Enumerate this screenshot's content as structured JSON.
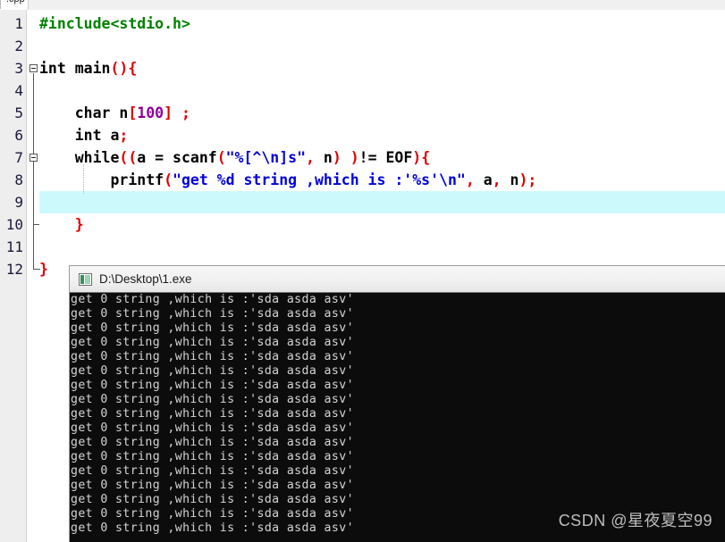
{
  "editor": {
    "tab_label": ".cpp",
    "gutter": {
      "line_numbers": [
        "1",
        "2",
        "3",
        "4",
        "5",
        "6",
        "7",
        "8",
        "9",
        "10",
        "11",
        "12"
      ]
    },
    "current_line": 9,
    "colors": {
      "preprocessor": "#008000",
      "punctuation": "#e00000",
      "string": "#0000dd",
      "number": "#9000a0",
      "plain": "#000000",
      "current_line_highlight": "#ccfafc",
      "gutter_background": "#eeeeee",
      "editor_background": "#ffffff"
    },
    "code_lines": [
      {
        "n": 1,
        "tokens": [
          {
            "t": "#include<stdio.h>",
            "c": "pre"
          }
        ]
      },
      {
        "n": 2,
        "tokens": []
      },
      {
        "n": 3,
        "tokens": [
          {
            "t": "int main",
            "c": "plain"
          },
          {
            "t": "(){",
            "c": "punc"
          }
        ]
      },
      {
        "n": 4,
        "tokens": []
      },
      {
        "n": 5,
        "tokens": [
          {
            "t": "    char n",
            "c": "plain"
          },
          {
            "t": "[",
            "c": "punc"
          },
          {
            "t": "100",
            "c": "num"
          },
          {
            "t": "]",
            "c": "punc"
          },
          {
            "t": " ",
            "c": "plain"
          },
          {
            "t": ";",
            "c": "punc"
          }
        ]
      },
      {
        "n": 6,
        "tokens": [
          {
            "t": "    int a",
            "c": "plain"
          },
          {
            "t": ";",
            "c": "punc"
          }
        ]
      },
      {
        "n": 7,
        "tokens": [
          {
            "t": "    while",
            "c": "plain"
          },
          {
            "t": "((",
            "c": "punc"
          },
          {
            "t": "a = scanf",
            "c": "plain"
          },
          {
            "t": "(",
            "c": "punc"
          },
          {
            "t": "\"%[^\\n]s\"",
            "c": "str"
          },
          {
            "t": ",",
            "c": "punc"
          },
          {
            "t": " n",
            "c": "plain"
          },
          {
            "t": ")",
            "c": "punc"
          },
          {
            "t": " ",
            "c": "plain"
          },
          {
            "t": ")",
            "c": "punc"
          },
          {
            "t": "!= EOF",
            "c": "plain"
          },
          {
            "t": "){",
            "c": "punc"
          }
        ]
      },
      {
        "n": 8,
        "tokens": [
          {
            "t": "        printf",
            "c": "plain"
          },
          {
            "t": "(",
            "c": "punc"
          },
          {
            "t": "\"get %d string ,which is :'%s'\\n\"",
            "c": "str"
          },
          {
            "t": ",",
            "c": "punc"
          },
          {
            "t": " a",
            "c": "plain"
          },
          {
            "t": ",",
            "c": "punc"
          },
          {
            "t": " n",
            "c": "plain"
          },
          {
            "t": ")",
            "c": "punc"
          },
          {
            "t": ";",
            "c": "punc"
          }
        ]
      },
      {
        "n": 9,
        "tokens": []
      },
      {
        "n": 10,
        "tokens": [
          {
            "t": "    }",
            "c": "punc"
          }
        ]
      },
      {
        "n": 11,
        "tokens": []
      },
      {
        "n": 12,
        "tokens": [
          {
            "t": "}",
            "c": "punc"
          }
        ]
      }
    ]
  },
  "console": {
    "title": "D:\\Desktop\\1.exe",
    "icon": "console-app-icon",
    "background": "#0c0c0c",
    "text_color": "#d4d4d4",
    "output_line_text": "get 0 string ,which is :'sda asda asv'",
    "output_lines": [
      "get 0 string ,which is :'sda asda asv'",
      "get 0 string ,which is :'sda asda asv'",
      "get 0 string ,which is :'sda asda asv'",
      "get 0 string ,which is :'sda asda asv'",
      "get 0 string ,which is :'sda asda asv'",
      "get 0 string ,which is :'sda asda asv'",
      "get 0 string ,which is :'sda asda asv'",
      "get 0 string ,which is :'sda asda asv'",
      "get 0 string ,which is :'sda asda asv'",
      "get 0 string ,which is :'sda asda asv'",
      "get 0 string ,which is :'sda asda asv'",
      "get 0 string ,which is :'sda asda asv'",
      "get 0 string ,which is :'sda asda asv'",
      "get 0 string ,which is :'sda asda asv'",
      "get 0 string ,which is :'sda asda asv'",
      "get 0 string ,which is :'sda asda asv'",
      "get 0 string ,which is :'sda asda asv'"
    ]
  },
  "watermark": {
    "text": "CSDN @星夜夏空99"
  }
}
